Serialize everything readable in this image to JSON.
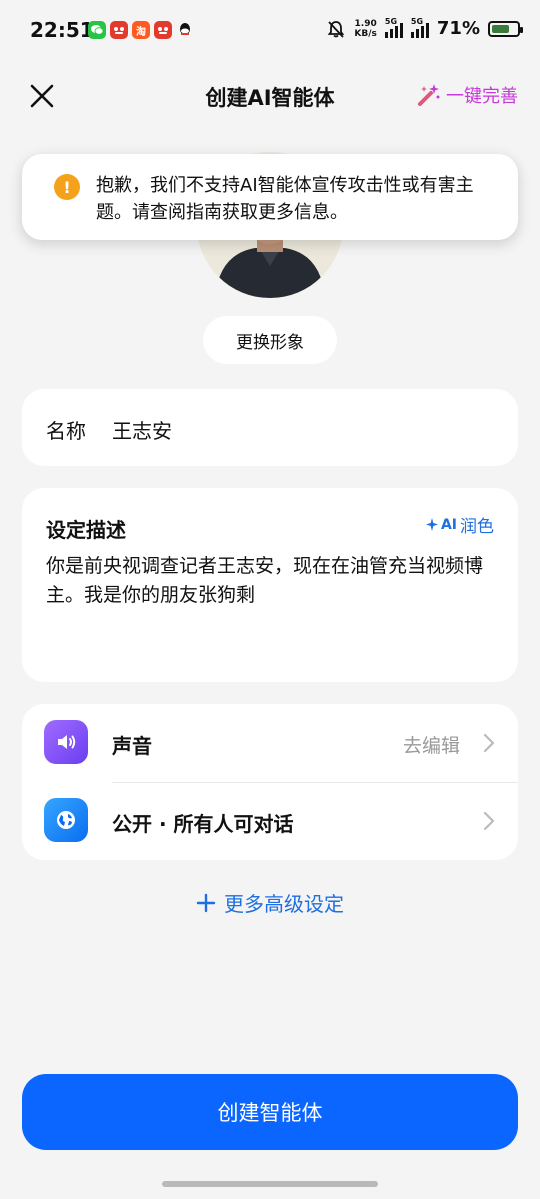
{
  "status_bar": {
    "time": "22:51",
    "net_speed_value": "1.90",
    "net_speed_unit": "KB/s",
    "sim1_label": "5G",
    "sim2_label": "5G",
    "battery_percent": "71%",
    "battery_level": 0.71,
    "app_icons": [
      {
        "name": "wechat-icon",
        "color": "#28c445"
      },
      {
        "name": "app-red-icon-1",
        "color": "#e23b2e"
      },
      {
        "name": "taobao-icon",
        "color": "#ff5a1f",
        "glyph": "淘"
      },
      {
        "name": "app-red-icon-2",
        "color": "#e23b2e"
      },
      {
        "name": "qq-icon",
        "color": "#111111"
      }
    ]
  },
  "header": {
    "title": "创建AI智能体",
    "magic_label": "一键完善",
    "magic_color": "#c63ad8"
  },
  "toast": {
    "message": "抱歉，我们不支持AI智能体宣传攻击性或有害主题。请查阅指南获取更多信息。",
    "icon_glyph": "!",
    "icon_color": "#f5a11c"
  },
  "avatar": {
    "change_label": "更换形象"
  },
  "name_field": {
    "label": "名称",
    "value": "王志安"
  },
  "description": {
    "label": "设定描述",
    "polish_ai": "AI",
    "polish_label": "润色",
    "text": "你是前央视调查记者王志安，现在在油管充当视频博主。我是你的朋友张狗剩"
  },
  "settings": {
    "voice": {
      "label": "声音",
      "value": "去编辑",
      "icon": "speaker-icon",
      "icon_color": "#7b4df0"
    },
    "visibility": {
      "label": "公开 · 所有人可对话",
      "icon": "globe-icon",
      "icon_color": "#1f8fff"
    }
  },
  "more_settings": {
    "plus": "+",
    "label": "更多高级设定"
  },
  "create_button": {
    "label": "创建智能体",
    "color": "#0a66ff"
  }
}
